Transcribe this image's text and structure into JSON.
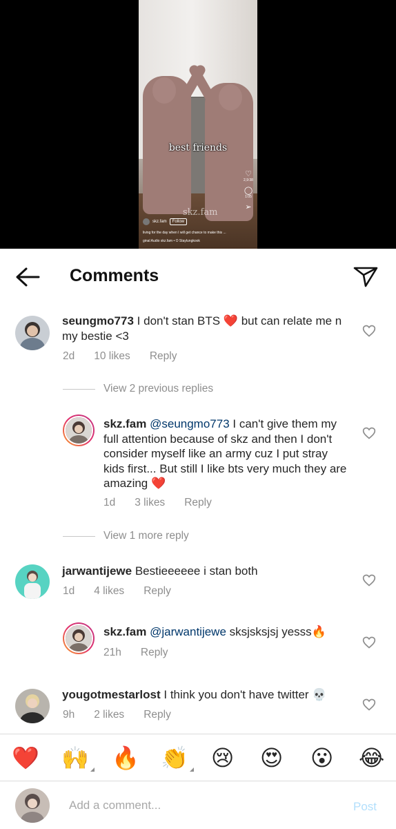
{
  "video": {
    "caption": "best friends",
    "watermark": "skz.fam",
    "username": "skz.fam",
    "follow_label": "Follow",
    "description": "living for the day when I will get chance to make this ...",
    "audio": "ginal Audio  skz.fam • O  Staylungkook",
    "like_count": "2,9:38",
    "comment_count": "1:05"
  },
  "header": {
    "title": "Comments"
  },
  "comments": [
    {
      "username": "seungmo773",
      "text": "I don't stan BTS ❤️ but can relate me n my bestie <3",
      "time": "2d",
      "likes": "10 likes",
      "reply_label": "Reply"
    },
    {
      "username": "skz.fam",
      "mention": "@seungmo773",
      "text": "I can't give them my full attention because of skz and then I don't consider myself like an army cuz I put stray kids first... But still I like bts very much they are amazing ❤️",
      "time": "1d",
      "likes": "3 likes",
      "reply_label": "Reply"
    },
    {
      "username": "jarwantijewe",
      "text": "Bestieeeeee i stan both",
      "time": "1d",
      "likes": "4 likes",
      "reply_label": "Reply"
    },
    {
      "username": "skz.fam",
      "mention": "@jarwantijewe",
      "text": "sksjsksjsj yesss🔥",
      "time": "21h",
      "reply_label": "Reply"
    },
    {
      "username": "yougotmestarlost",
      "text": "I think you don't have twitter 💀",
      "time": "9h",
      "likes": "2 likes",
      "reply_label": "Reply"
    }
  ],
  "view_replies": [
    "View 2 previous replies",
    "View 1 more reply"
  ],
  "emoji_bar": [
    "❤️",
    "🙌",
    "🔥",
    "👏",
    "😢",
    "😍",
    "😮",
    "😂"
  ],
  "composer": {
    "placeholder": "Add a comment...",
    "post_label": "Post"
  },
  "colors": {
    "mention": "#00376b",
    "muted": "#8e8e8e",
    "post_disabled": "#b2dffc"
  }
}
